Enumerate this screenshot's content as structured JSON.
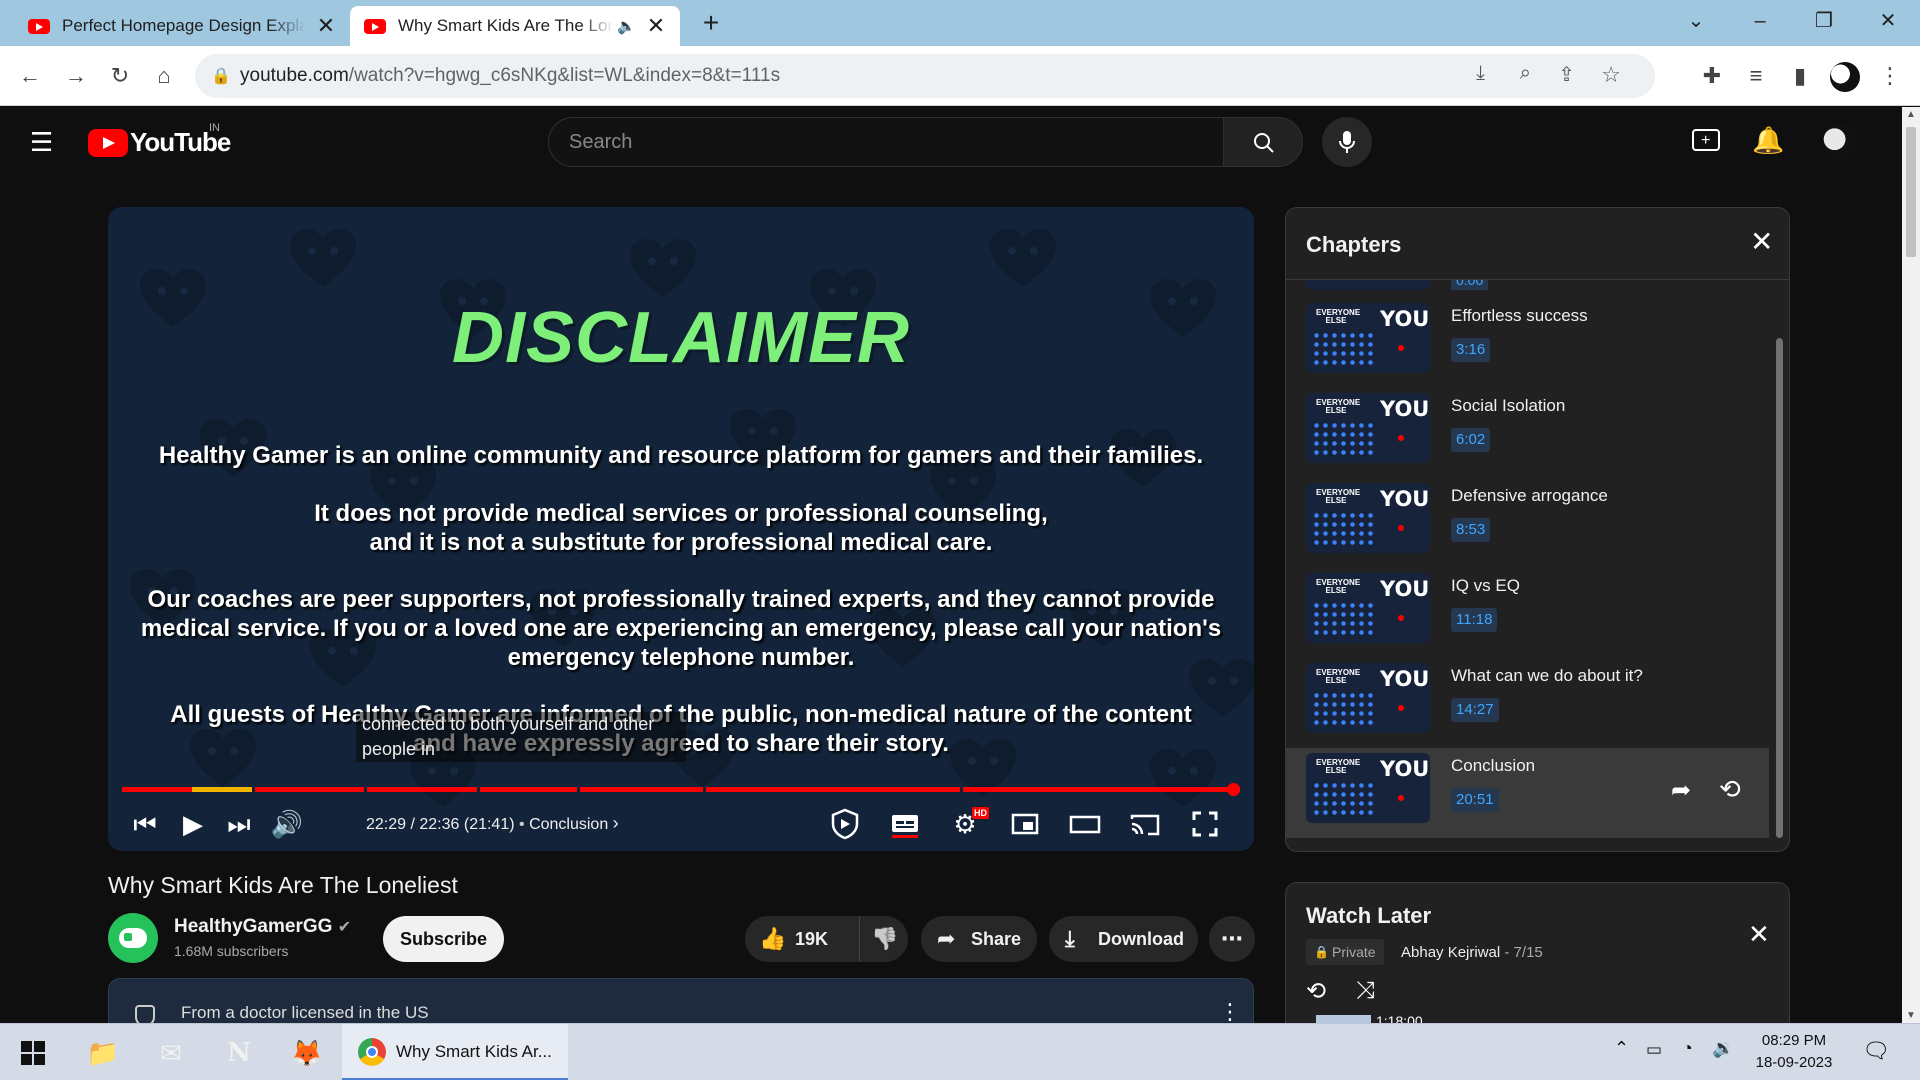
{
  "browser": {
    "tabs": [
      {
        "title": "Perfect Homepage Design Explai"
      },
      {
        "title": "Why Smart Kids Are The Lonel"
      }
    ],
    "url_host": "youtube.com",
    "url_path": "/watch?v=hgwg_c6sNKg&list=WL&index=8&t=111s"
  },
  "youtube": {
    "logo_text": "YouTube",
    "region": "IN",
    "search_placeholder": "Search"
  },
  "video": {
    "disclaimer_title": "DISCLAIMER",
    "disclaimer_lines": [
      "Healthy Gamer is an online community and resource platform for gamers and their families.",
      "It does not provide medical services or professional counseling,",
      "and it is not a substitute for professional medical care.",
      "Our coaches are peer supporters, not professionally trained experts, and they cannot provide",
      "medical service. If you or a loved one are experiencing an emergency, please call your nation's",
      "emergency telephone number.",
      "All guests of Healthy Gamer are informed of the public, non-medical nature of the content",
      "and have expressly agreed to share their story."
    ],
    "caption_line1": "connected to both yourself and other",
    "caption_line2": "people in",
    "time": "22:29 / 22:36 (21:41)",
    "chapter_label": "Conclusion",
    "hd_badge": "HD",
    "progress_fraction": 0.994,
    "title": "Why Smart Kids Are The Loneliest",
    "channel": "HealthyGamerGG",
    "subscribers": "1.68M subscribers",
    "subscribe_label": "Subscribe",
    "likes": "19K",
    "share_label": "Share",
    "download_label": "Download",
    "description_snippet": "From a doctor licensed in the US"
  },
  "chapters_panel": {
    "title": "Chapters",
    "partial_time": "0:00",
    "thumb_text_small": "EVERYONE ELSE",
    "thumb_text_big": "YOU",
    "items": [
      {
        "name": "Effortless success",
        "time": "3:16"
      },
      {
        "name": "Social Isolation",
        "time": "6:02"
      },
      {
        "name": "Defensive arrogance",
        "time": "8:53"
      },
      {
        "name": "IQ vs EQ",
        "time": "11:18"
      },
      {
        "name": "What can we do about it?",
        "time": "14:27"
      },
      {
        "name": "Conclusion",
        "time": "20:51"
      }
    ]
  },
  "watch_later": {
    "title": "Watch Later",
    "privacy": "Private",
    "owner": "Abhay Kejriwal",
    "position": "- 7/15",
    "partial_item_time": "1:18:00"
  },
  "taskbar": {
    "chrome_label": "Why Smart Kids Ar...",
    "time": "08:29 PM",
    "date": "18-09-2023"
  },
  "colors": {
    "accent_red": "#ff0000",
    "disclaimer_green": "#7ef07a",
    "chapter_time_blue": "#3ea6ff"
  }
}
